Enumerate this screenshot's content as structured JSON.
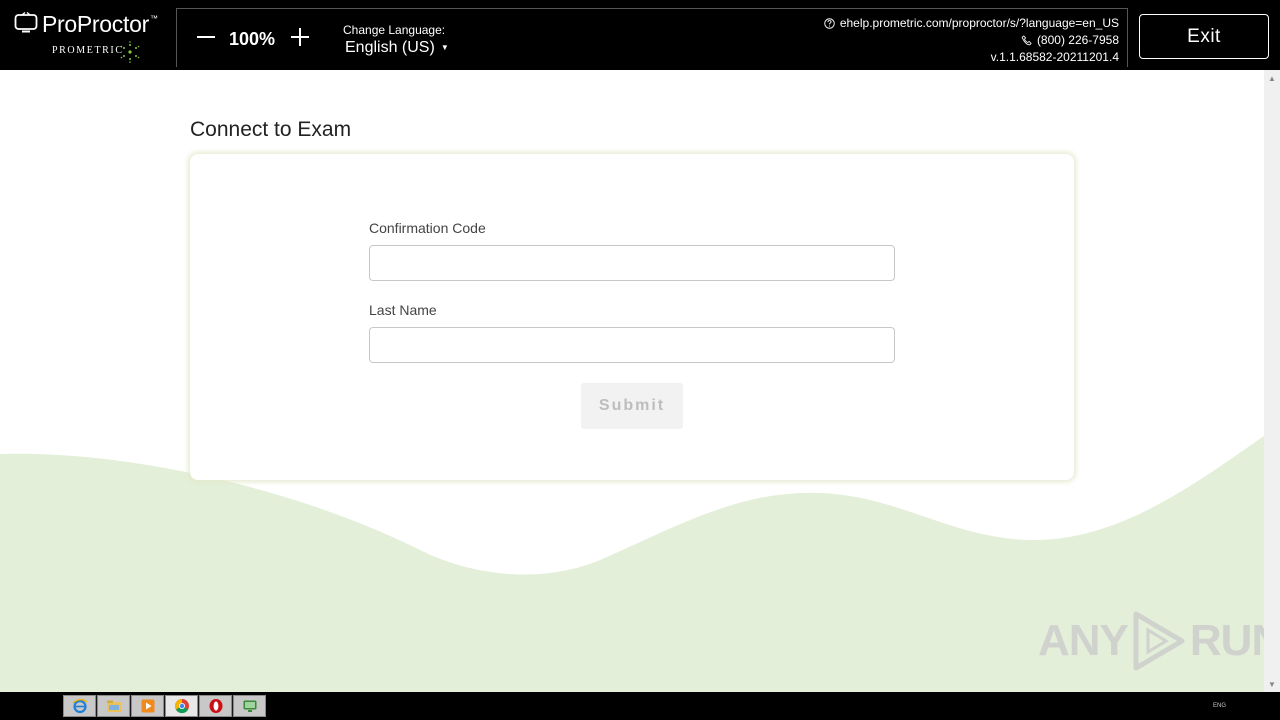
{
  "header": {
    "brand_name": "ProProctor",
    "brand_tm": "™",
    "brand_sub": "PROMETRIC",
    "zoom_level": "100%",
    "change_language_label": "Change Language:",
    "language_value": "English (US)",
    "language_caret": "▼",
    "help_url": "ehelp.prometric.com/proproctor/s/?language=en_US",
    "phone": "(800) 226-7958",
    "version": "v.1.1.68582-20211201.4",
    "exit_label": "Exit"
  },
  "main": {
    "page_title": "Connect to Exam",
    "form": {
      "confirmation_label": "Confirmation Code",
      "confirmation_value": "",
      "last_name_label": "Last Name",
      "last_name_value": "",
      "submit_label": "Submit"
    }
  },
  "watermark": {
    "left_text": "ANY",
    "right_text": "RUN"
  },
  "taskbar": {
    "icons": [
      "ie-icon",
      "file-explorer-icon",
      "media-player-icon",
      "chrome-icon",
      "opera-icon",
      "proproctor-app-icon"
    ],
    "tray_text": "ENG"
  },
  "colors": {
    "header_bg": "#000000",
    "wave_fill": "#e4efd9",
    "card_glow": "#e1e8c8",
    "submit_disabled_bg": "#f2f2f2",
    "submit_disabled_text": "#bdbdbd"
  }
}
